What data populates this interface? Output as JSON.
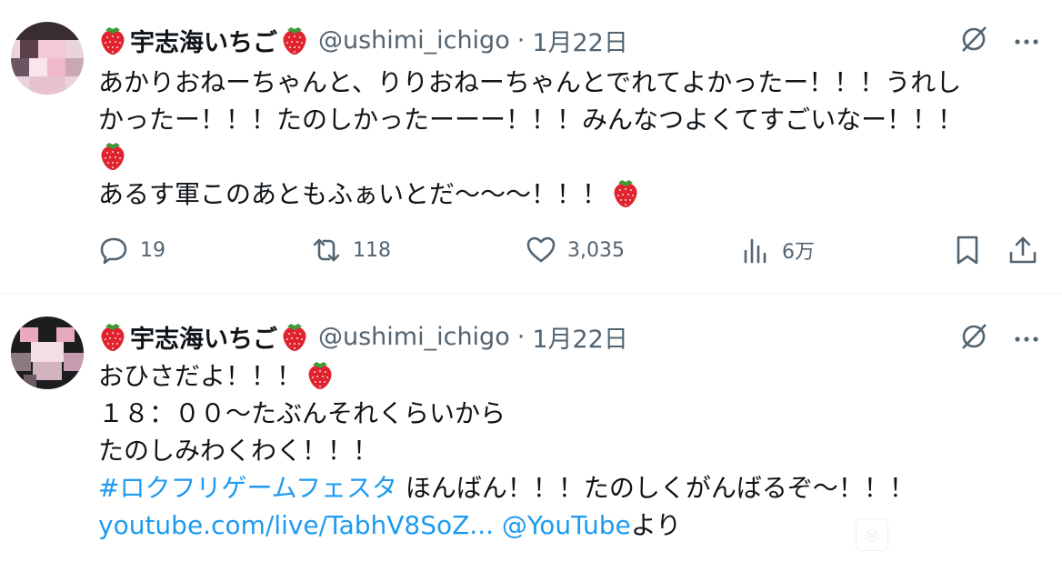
{
  "tweets": [
    {
      "author": {
        "name": "宇志海いちご",
        "handle": "@ushimi_ichigo",
        "date": "1月22日",
        "name_emoji": "strawberry"
      },
      "lines": [
        "あかりおねーちゃんと、りりおねーちゃんとでれてよかったー！！！うれし",
        "かったー！！！たのしかったーーー！！！みんなつよくてすごいなー！！！",
        "",
        "あるす軍このあともふぁいとだ〜〜〜！！！"
      ],
      "stats": {
        "replies": "19",
        "reposts": "118",
        "likes": "3,035",
        "views": "6万"
      }
    },
    {
      "author": {
        "name": "宇志海いちご",
        "handle": "@ushimi_ichigo",
        "date": "1月22日",
        "name_emoji": "strawberry"
      },
      "lines": [
        "おひさだよ！！！",
        "１８：００〜たぶんそれくらいから",
        "たのしみわくわく！！！"
      ],
      "hashtag": "#ロクフリゲームフェスタ",
      "hashtag_after": " ほんばん！！！たのしくがんばるぞ〜！！！",
      "link": "youtube.com/live/TabhV8SoZ...",
      "mention": "@YouTube",
      "mention_after": "より"
    }
  ],
  "icons": {
    "grok": "grok-icon",
    "more": "more-icon",
    "reply": "reply-icon",
    "repost": "repost-icon",
    "like": "like-icon",
    "views": "views-icon",
    "bookmark": "bookmark-icon",
    "share": "share-icon"
  },
  "colors": {
    "text": "#0f1419",
    "secondary": "#536471",
    "link": "#1d9bf0",
    "strawberry": "#e0242f"
  }
}
